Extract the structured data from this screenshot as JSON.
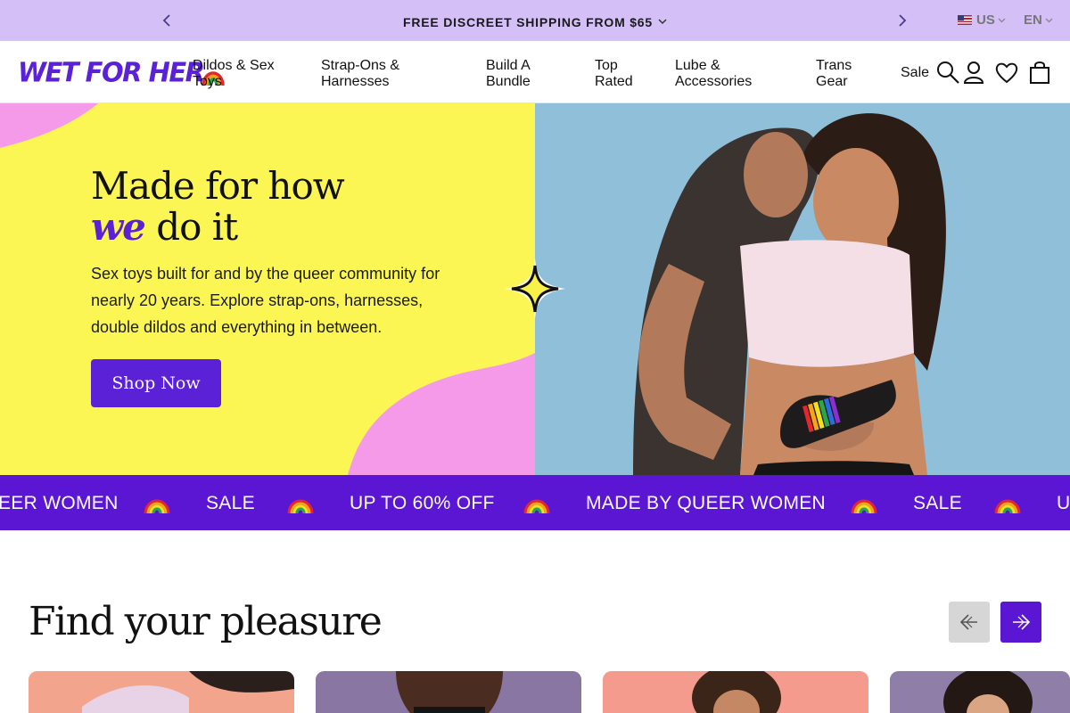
{
  "announcement": {
    "message": "FREE DISCREET SHIPPING FROM $65",
    "country": "US",
    "language": "EN"
  },
  "header": {
    "logo_text": "WET FOR HER",
    "nav": [
      {
        "line1": "Dildos & Sex",
        "line2": "Toys"
      },
      {
        "line1": "Strap-Ons &",
        "line2": "Harnesses"
      },
      {
        "line1": "Build A",
        "line2": "Bundle"
      },
      {
        "line1": "Top",
        "line2": "Rated"
      },
      {
        "line1": "Lube &",
        "line2": "Accessories"
      },
      {
        "line1": "Trans",
        "line2": "Gear"
      }
    ],
    "sale": "Sale",
    "icons": [
      "search-icon",
      "account-icon",
      "wishlist-heart-icon",
      "cart-bag-icon"
    ]
  },
  "hero": {
    "headline_line1": "Made for how",
    "headline_we": "we",
    "headline_rest": " do it",
    "subcopy": "Sex toys built for and by the queer community for nearly 20 years. Explore strap-ons, harnesses, double dildos and everything in between.",
    "cta": "Shop Now"
  },
  "ticker": {
    "items": [
      "EER WOMEN",
      "SALE",
      "UP TO 60% OFF",
      "MADE BY QUEER WOMEN",
      "SALE",
      "U"
    ],
    "separator_icon": "rainbow-icon"
  },
  "section": {
    "title": "Find your pleasure"
  },
  "colors": {
    "brand_purple": "#5b21d6",
    "announce_bg": "#d4bff7",
    "hero_yellow": "#fbf654",
    "hero_pink": "#f49ae8",
    "hero_blue": "#8fbfd9"
  }
}
